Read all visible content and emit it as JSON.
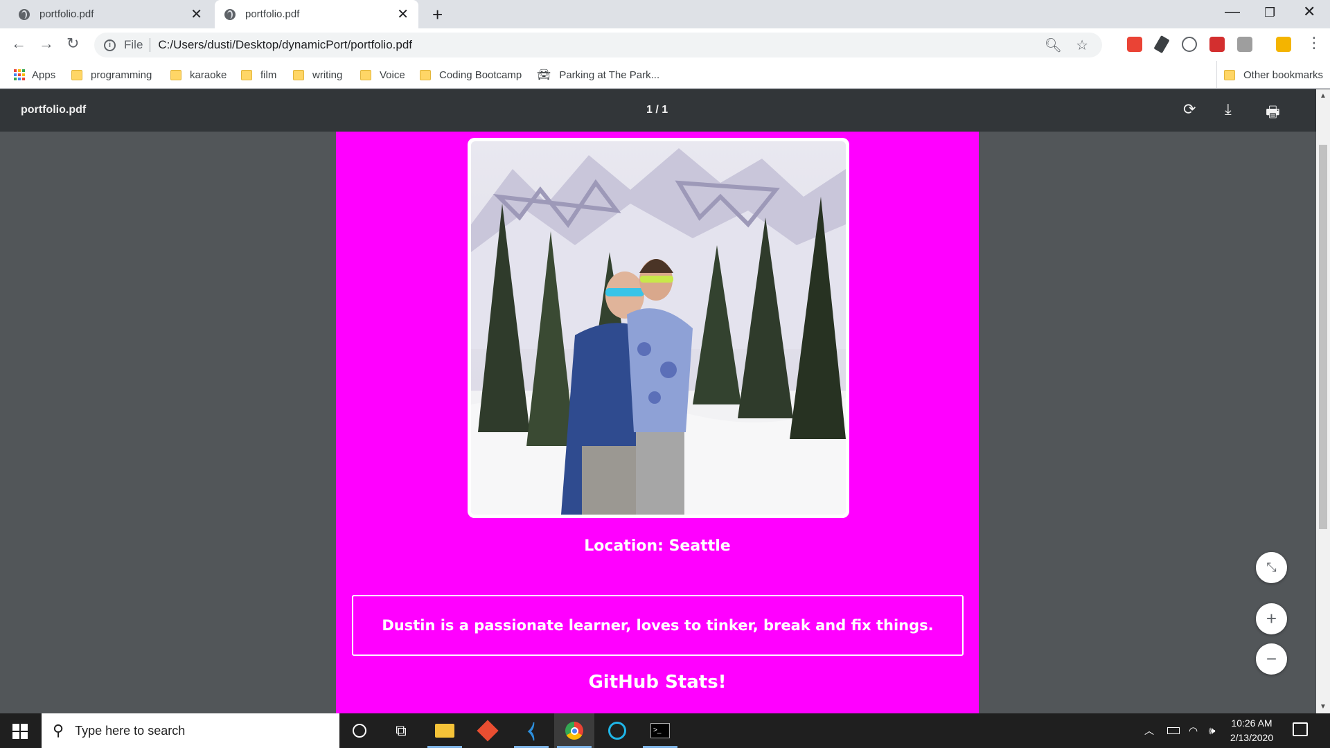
{
  "browser": {
    "tabs": [
      {
        "title": "portfolio.pdf",
        "active": false
      },
      {
        "title": "portfolio.pdf",
        "active": true
      }
    ],
    "address": {
      "scheme_label": "File",
      "url": "C:/Users/dusti/Desktop/dynamicPort/portfolio.pdf"
    },
    "bookmarks": [
      {
        "label": "Apps",
        "icon": "apps-grid-icon"
      },
      {
        "label": "programming",
        "icon": "folder-icon"
      },
      {
        "label": "karaoke",
        "icon": "folder-icon"
      },
      {
        "label": "film",
        "icon": "folder-icon"
      },
      {
        "label": "writing",
        "icon": "folder-icon"
      },
      {
        "label": "Voice",
        "icon": "folder-icon"
      },
      {
        "label": "Coding Bootcamp",
        "icon": "folder-icon"
      },
      {
        "label": "Parking at The Park...",
        "icon": "car-icon"
      }
    ],
    "other_bookmarks": "Other bookmarks"
  },
  "pdf": {
    "title": "portfolio.pdf",
    "page_indicator": "1 / 1",
    "background_color": "#ff00ff",
    "location": "Location: Seattle",
    "bio": "Dustin is a passionate learner, loves to tinker, break and fix things.",
    "stats_heading": "GitHub Stats!"
  },
  "taskbar": {
    "search_placeholder": "Type here to search",
    "time": "10:26 AM",
    "date": "2/13/2020"
  },
  "colors": {
    "accent": "#ff00ff",
    "pdf_toolbar": "#323639",
    "viewer_bg": "#525659",
    "taskbar": "#1f1f1f"
  }
}
